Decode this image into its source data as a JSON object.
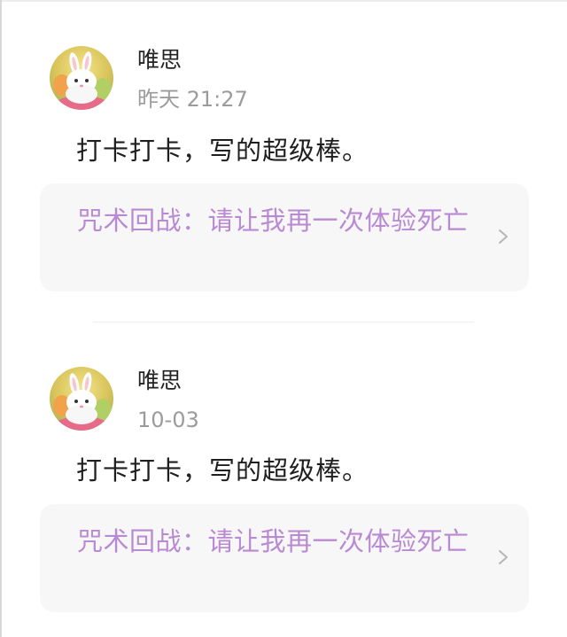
{
  "comments": [
    {
      "username": "唯思",
      "timestamp": "昨天 21:27",
      "text": "打卡打卡，写的超级棒。",
      "link_title": "咒术回战：请让我再一次体验死亡"
    },
    {
      "username": "唯思",
      "timestamp": "10-03",
      "text": "打卡打卡，写的超级棒。",
      "link_title": "咒术回战：请让我再一次体验死亡"
    }
  ],
  "icons": {
    "avatar": "rabbit-avatar-icon",
    "link_arrow": "chevron-right-icon"
  },
  "colors": {
    "link_text": "#b98ad3",
    "username": "#222222",
    "timestamp": "#9b9b9b",
    "card_bg": "#f7f7f7"
  }
}
